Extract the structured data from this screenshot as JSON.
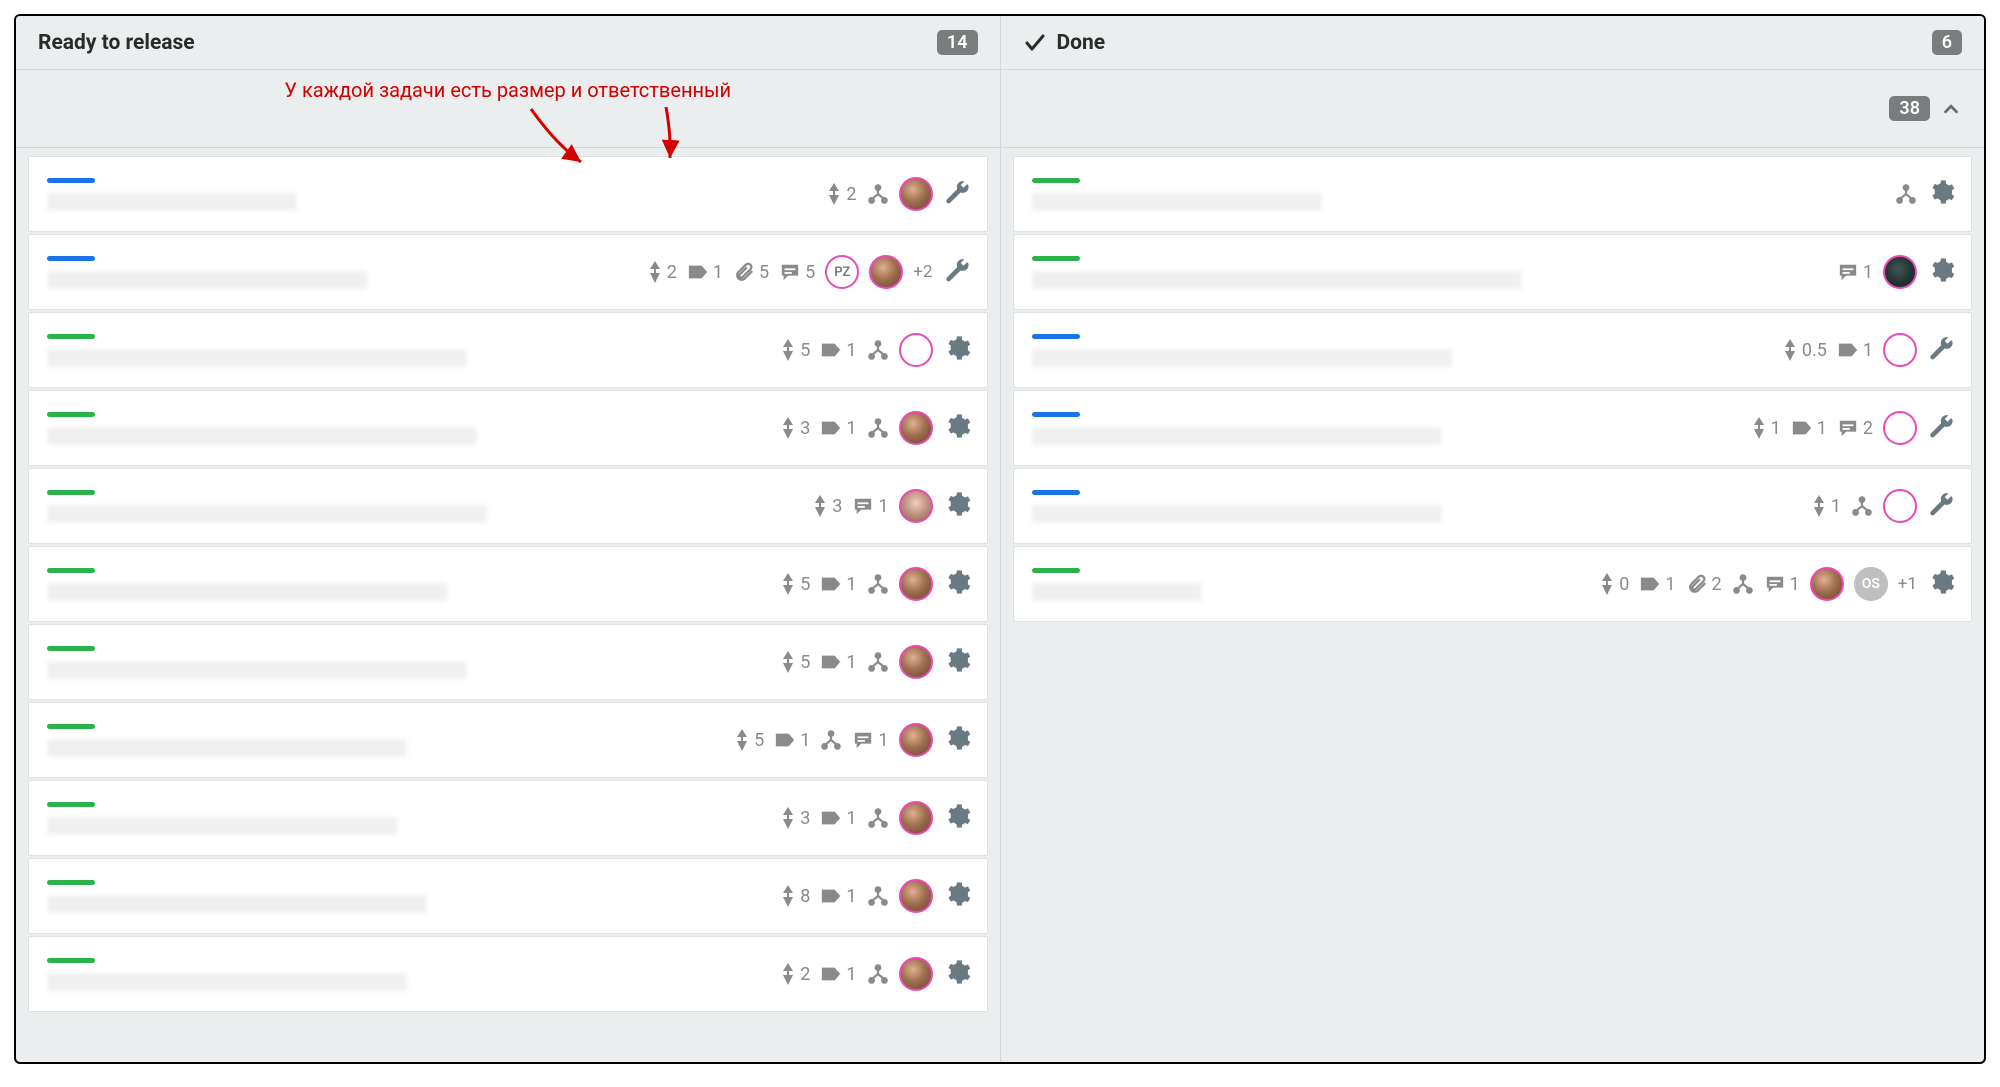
{
  "annotation": {
    "text": "У каждой задачи есть размер и ответственный"
  },
  "group": {
    "count": "38"
  },
  "columns": [
    {
      "id": "ready",
      "title": "Ready to release",
      "count": "14",
      "has_check_icon": false,
      "cards": [
        {
          "color": "blue",
          "text_width": 250,
          "meta": [
            {
              "type": "size",
              "val": "2"
            },
            {
              "type": "tree"
            }
          ],
          "avatars": [
            {
              "kind": "photo"
            }
          ],
          "action": "wrench"
        },
        {
          "color": "blue",
          "text_width": 320,
          "meta": [
            {
              "type": "size",
              "val": "2"
            },
            {
              "type": "tag",
              "val": "1"
            },
            {
              "type": "attach",
              "val": "5"
            },
            {
              "type": "chat",
              "val": "5"
            }
          ],
          "avatars": [
            {
              "kind": "initials",
              "text": "PZ"
            },
            {
              "kind": "photo"
            }
          ],
          "overflow": "+2",
          "action": "wrench"
        },
        {
          "color": "green",
          "text_width": 420,
          "meta": [
            {
              "type": "size",
              "val": "5"
            },
            {
              "type": "tag",
              "val": "1"
            },
            {
              "type": "tree"
            }
          ],
          "avatars": [
            {
              "kind": "empty"
            }
          ],
          "action": "gear"
        },
        {
          "color": "green",
          "text_width": 430,
          "meta": [
            {
              "type": "size",
              "val": "3"
            },
            {
              "type": "tag",
              "val": "1"
            },
            {
              "type": "tree"
            }
          ],
          "avatars": [
            {
              "kind": "photo"
            }
          ],
          "action": "gear"
        },
        {
          "color": "green",
          "text_width": 440,
          "meta": [
            {
              "type": "size",
              "val": "3"
            },
            {
              "type": "chat",
              "val": "1"
            }
          ],
          "avatars": [
            {
              "kind": "photo2"
            }
          ],
          "action": "gear"
        },
        {
          "color": "green",
          "text_width": 400,
          "meta": [
            {
              "type": "size",
              "val": "5"
            },
            {
              "type": "tag",
              "val": "1"
            },
            {
              "type": "tree"
            }
          ],
          "avatars": [
            {
              "kind": "photo"
            }
          ],
          "action": "gear"
        },
        {
          "color": "green",
          "text_width": 420,
          "meta": [
            {
              "type": "size",
              "val": "5"
            },
            {
              "type": "tag",
              "val": "1"
            },
            {
              "type": "tree"
            }
          ],
          "avatars": [
            {
              "kind": "photo"
            }
          ],
          "action": "gear"
        },
        {
          "color": "green",
          "text_width": 360,
          "meta": [
            {
              "type": "size",
              "val": "5"
            },
            {
              "type": "tag",
              "val": "1"
            },
            {
              "type": "tree"
            },
            {
              "type": "chat",
              "val": "1"
            }
          ],
          "avatars": [
            {
              "kind": "photo"
            }
          ],
          "action": "gear"
        },
        {
          "color": "green",
          "text_width": 350,
          "meta": [
            {
              "type": "size",
              "val": "3"
            },
            {
              "type": "tag",
              "val": "1"
            },
            {
              "type": "tree"
            }
          ],
          "avatars": [
            {
              "kind": "photo"
            }
          ],
          "action": "gear"
        },
        {
          "color": "green",
          "text_width": 380,
          "meta": [
            {
              "type": "size",
              "val": "8"
            },
            {
              "type": "tag",
              "val": "1"
            },
            {
              "type": "tree"
            }
          ],
          "avatars": [
            {
              "kind": "photo"
            }
          ],
          "action": "gear"
        },
        {
          "color": "green",
          "text_width": 360,
          "meta": [
            {
              "type": "size",
              "val": "2"
            },
            {
              "type": "tag",
              "val": "1"
            },
            {
              "type": "tree"
            }
          ],
          "avatars": [
            {
              "kind": "photo"
            }
          ],
          "action": "gear"
        }
      ]
    },
    {
      "id": "done",
      "title": "Done",
      "count": "6",
      "has_check_icon": true,
      "cards": [
        {
          "color": "green",
          "text_width": 290,
          "meta": [
            {
              "type": "tree"
            }
          ],
          "avatars": [],
          "action": "gear"
        },
        {
          "color": "green",
          "text_width": 490,
          "meta": [
            {
              "type": "chat",
              "val": "1"
            }
          ],
          "avatars": [
            {
              "kind": "photo3"
            }
          ],
          "action": "gear"
        },
        {
          "color": "blue",
          "text_width": 420,
          "meta": [
            {
              "type": "size",
              "val": "0.5"
            },
            {
              "type": "tag",
              "val": "1"
            }
          ],
          "avatars": [
            {
              "kind": "empty"
            }
          ],
          "action": "wrench"
        },
        {
          "color": "blue",
          "text_width": 410,
          "meta": [
            {
              "type": "size",
              "val": "1"
            },
            {
              "type": "tag",
              "val": "1"
            },
            {
              "type": "chat",
              "val": "2"
            }
          ],
          "avatars": [
            {
              "kind": "empty"
            }
          ],
          "action": "wrench"
        },
        {
          "color": "blue",
          "text_width": 410,
          "meta": [
            {
              "type": "size",
              "val": "1"
            },
            {
              "type": "tree"
            }
          ],
          "avatars": [
            {
              "kind": "empty"
            }
          ],
          "action": "wrench"
        },
        {
          "color": "green",
          "text_width": 170,
          "meta": [
            {
              "type": "size",
              "val": "0"
            },
            {
              "type": "tag",
              "val": "1"
            },
            {
              "type": "attach",
              "val": "2"
            },
            {
              "type": "tree"
            },
            {
              "type": "chat",
              "val": "1"
            }
          ],
          "avatars": [
            {
              "kind": "photo"
            },
            {
              "kind": "grey",
              "text": "OS"
            }
          ],
          "overflow": "+1",
          "action": "gear"
        }
      ]
    }
  ]
}
